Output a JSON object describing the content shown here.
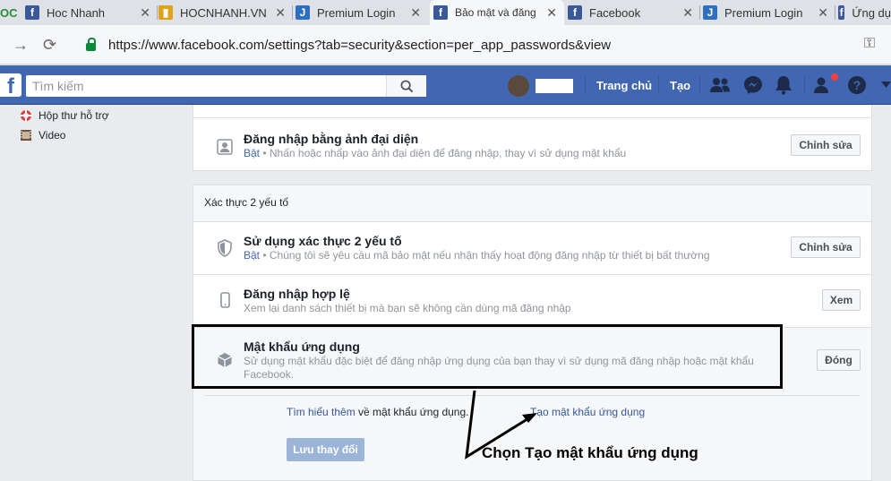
{
  "browser": {
    "tabs": [
      {
        "title": "Hoc Nhanh",
        "icon": "facebook-favicon"
      },
      {
        "title": "HOCNHANH.VN",
        "icon": "hocnhanh-favicon"
      },
      {
        "title": "Premium Login",
        "icon": "premium-favicon"
      },
      {
        "title": "Bảo mật và đăng",
        "icon": "facebook-favicon",
        "active": true
      },
      {
        "title": "Facebook",
        "icon": "facebook-favicon"
      },
      {
        "title": "Premium Login",
        "icon": "premium-favicon"
      },
      {
        "title": "Ứng dụ",
        "icon": "facebook-favicon"
      }
    ],
    "url": "https://www.facebook.com/settings?tab=security&section=per_app_passwords&view"
  },
  "fbbar": {
    "search_placeholder": "Tìm kiếm",
    "home_label": "Trang chủ",
    "create_label": "Tạo"
  },
  "sidebar": {
    "items": [
      {
        "label": "Hộp thư hỗ trợ",
        "icon": "lifebuoy-icon"
      },
      {
        "label": "Video",
        "icon": "film-icon"
      }
    ]
  },
  "settings": {
    "profile_login": {
      "title": "Đăng nhập bằng ảnh đại diện",
      "status": "Bật",
      "desc": " • Nhấn hoặc nhấp vào ảnh đại diện để đăng nhập, thay vì sử dụng mật khẩu",
      "button": "Chỉnh sửa"
    },
    "twofa_header": "Xác thực 2 yếu tố",
    "twofa": {
      "title": "Sử dụng xác thực 2 yếu tố",
      "status": "Bật",
      "desc": " • Chúng tôi sẽ yêu cầu mã bảo mật nếu nhận thấy hoạt động đăng nhập từ thiết bị bất thường",
      "button": "Chỉnh sửa"
    },
    "authorized": {
      "title": "Đăng nhập hợp lệ",
      "desc": "Xem lại danh sách thiết bị mà bạn sẽ không cần dùng mã đăng nhập",
      "button": "Xem"
    },
    "app_passwords": {
      "title": "Mật khẩu ứng dụng",
      "desc": "Sử dụng mật khẩu đặc biệt để đăng nhập ứng dụng của bạn thay vì sử dụng mã đăng nhập hoặc mật khẩu Facebook.",
      "button": "Đóng",
      "learn_more": "Tìm hiểu thêm",
      "learn_more_suffix": " về mật khẩu ứng dụng.",
      "create_link": "Tạo mật khẩu ứng dụng",
      "save_button": "Lưu thay đổi"
    }
  },
  "annotation": {
    "text": "Chọn Tạo mật khẩu ứng dụng"
  }
}
